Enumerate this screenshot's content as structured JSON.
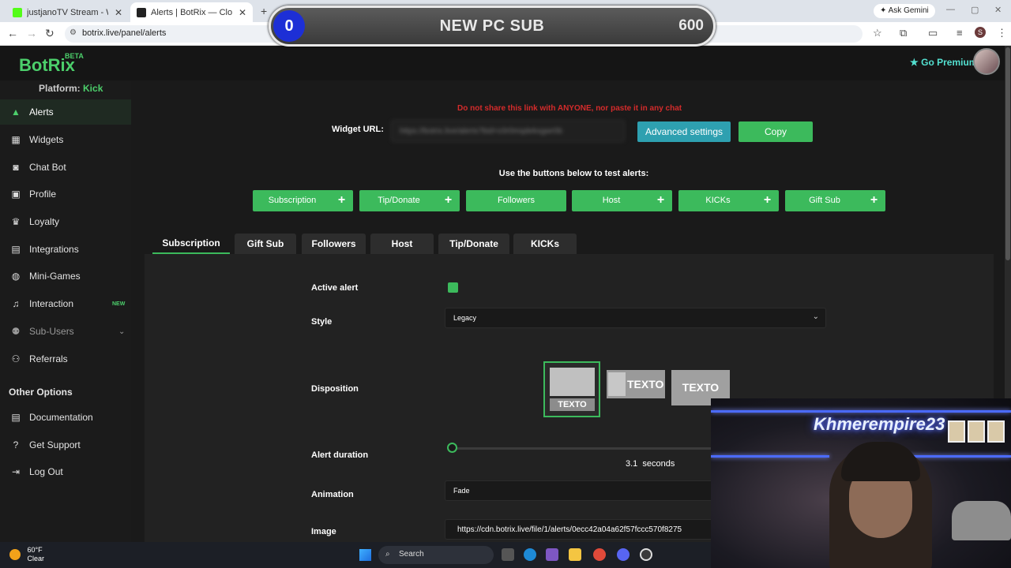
{
  "browser": {
    "tabs": [
      {
        "title": "justjanoTV Stream - Watch Live",
        "favicon_color": "#53fc18"
      },
      {
        "title": "Alerts | BotRix — Cloud Stream",
        "favicon_color": "#222222"
      }
    ],
    "url": "botrix.live/panel/alerts",
    "gemini": "Ask Gemini",
    "profile_initial": "S"
  },
  "overlay": {
    "count": "0",
    "title": "NEW PC SUB",
    "goal": "600",
    "progress": 0
  },
  "header": {
    "logo": "BotRix",
    "beta": "BETA",
    "premium": "Go Premium"
  },
  "sidebar": {
    "platform_label": "Platform:",
    "platform_value": "Kick",
    "items": [
      {
        "label": "Alerts",
        "icon": "warning-icon"
      },
      {
        "label": "Widgets",
        "icon": "widgets-icon"
      },
      {
        "label": "Chat Bot",
        "icon": "robot-icon"
      },
      {
        "label": "Profile",
        "icon": "profile-card-icon"
      },
      {
        "label": "Loyalty",
        "icon": "trophy-icon"
      },
      {
        "label": "Integrations",
        "icon": "plug-icon"
      },
      {
        "label": "Mini-Games",
        "icon": "gamepad-icon"
      },
      {
        "label": "Interaction",
        "icon": "music-icon",
        "badge": "NEW"
      },
      {
        "label": "Sub-Users",
        "icon": "users-icon"
      },
      {
        "label": "Referrals",
        "icon": "referral-icon"
      }
    ],
    "other_title": "Other Options",
    "other_items": [
      {
        "label": "Documentation",
        "icon": "document-icon"
      },
      {
        "label": "Get Support",
        "icon": "question-icon"
      },
      {
        "label": "Log Out",
        "icon": "logout-icon"
      }
    ]
  },
  "main": {
    "warning": "Do not share this link with ANYONE, nor paste it in any chat",
    "widget_label": "Widget URL:",
    "widget_url": "https://botrix.live/alerts?bid=c0r0mqdeksgwr0b",
    "advanced_label": "Advanced settings",
    "copy_label": "Copy",
    "test_label": "Use the buttons below to test alerts:",
    "test_buttons": [
      {
        "label": "Subscription",
        "plus": true
      },
      {
        "label": "Tip/Donate",
        "plus": true
      },
      {
        "label": "Followers",
        "plus": false
      },
      {
        "label": "Host",
        "plus": true
      },
      {
        "label": "KICKs",
        "plus": true
      },
      {
        "label": "Gift Sub",
        "plus": true
      }
    ],
    "tabs": [
      "Subscription",
      "Gift Sub",
      "Followers",
      "Host",
      "Tip/Donate",
      "KICKs"
    ],
    "active_tab": "Subscription",
    "form": {
      "active_label": "Active alert",
      "active_checked": true,
      "style_label": "Style",
      "style_value": "Legacy",
      "disposition_label": "Disposition",
      "disposition_text": "TEXTO",
      "duration_label": "Alert duration",
      "duration_value": "3.1",
      "duration_unit": "seconds",
      "animation_label": "Animation",
      "animation_value": "Fade",
      "image_label": "Image",
      "image_value": "https://cdn.botrix.live/file/1/alerts/0ecc42a04a62f57fccc570f8275"
    }
  },
  "webcam": {
    "sign": "Khmerempire23"
  },
  "taskbar": {
    "temp": "60°F",
    "weather": "Clear",
    "search": "Search"
  }
}
